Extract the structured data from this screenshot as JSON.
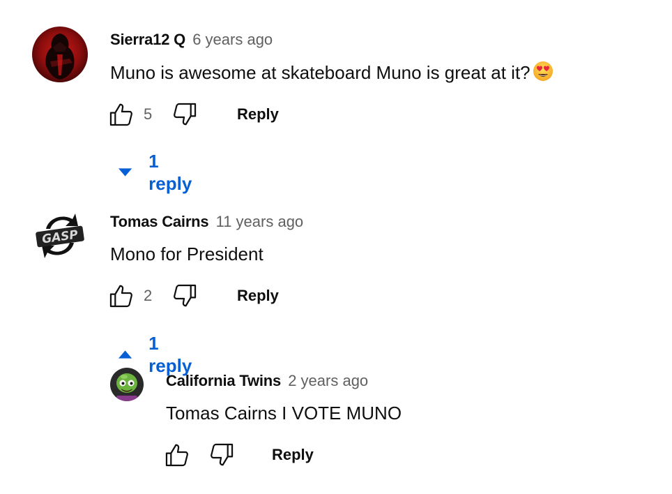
{
  "comments": [
    {
      "author": "Sierra12 Q",
      "time": "6 years ago",
      "text": "Muno is awesome at skateboard Muno is great at it?",
      "emoji": "heart-eyes-emoji",
      "likes": "5",
      "reply_label": "Reply",
      "replies_toggle": {
        "label": "1 reply",
        "state": "collapsed"
      },
      "avatar_icon": "dark-figure-avatar"
    },
    {
      "author": "Tomas Cairns",
      "time": "11 years ago",
      "text": "Mono for President",
      "likes": "2",
      "reply_label": "Reply",
      "replies_toggle": {
        "label": "1 reply",
        "state": "expanded"
      },
      "avatar_icon": "gasp-logo-avatar",
      "avatar_logo_text": "GASP",
      "replies": [
        {
          "author": "California Twins",
          "time": "2 years ago",
          "text": "Tomas Cairns I VOTE MUNO",
          "likes": "",
          "reply_label": "Reply",
          "avatar_icon": "green-zombie-avatar"
        }
      ]
    }
  ],
  "colors": {
    "link_blue": "#065fd4",
    "meta_gray": "#606060",
    "text": "#0f0f0f",
    "avatar_red": "#8b1010"
  },
  "icons": {
    "like": "thumbs-up-icon",
    "dislike": "thumbs-down-icon",
    "expand": "caret-down-icon",
    "collapse": "caret-up-icon"
  }
}
